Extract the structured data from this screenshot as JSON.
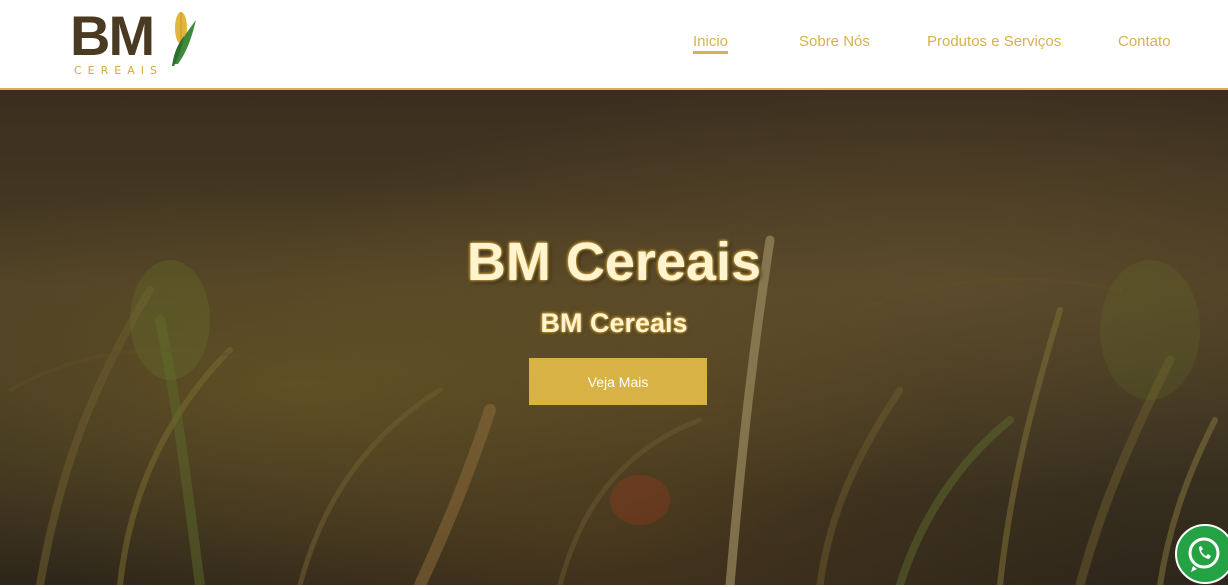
{
  "brand": {
    "logo_text": "BM",
    "logo_subtext": "CEREAIS",
    "colors": {
      "gold": "#d7b24c",
      "dark_brown": "#4a3a22",
      "whatsapp_green": "#25a244"
    }
  },
  "nav": {
    "items": [
      {
        "label": "Inicio",
        "active": true
      },
      {
        "label": "Sobre Nós",
        "active": false
      },
      {
        "label": "Produtos e Serviços",
        "active": false
      },
      {
        "label": "Contato",
        "active": false
      }
    ]
  },
  "hero": {
    "title": "BM Cereais",
    "subtitle": "BM Cereais",
    "cta_label": "Veja Mais"
  },
  "floating": {
    "icon": "whatsapp-icon"
  }
}
